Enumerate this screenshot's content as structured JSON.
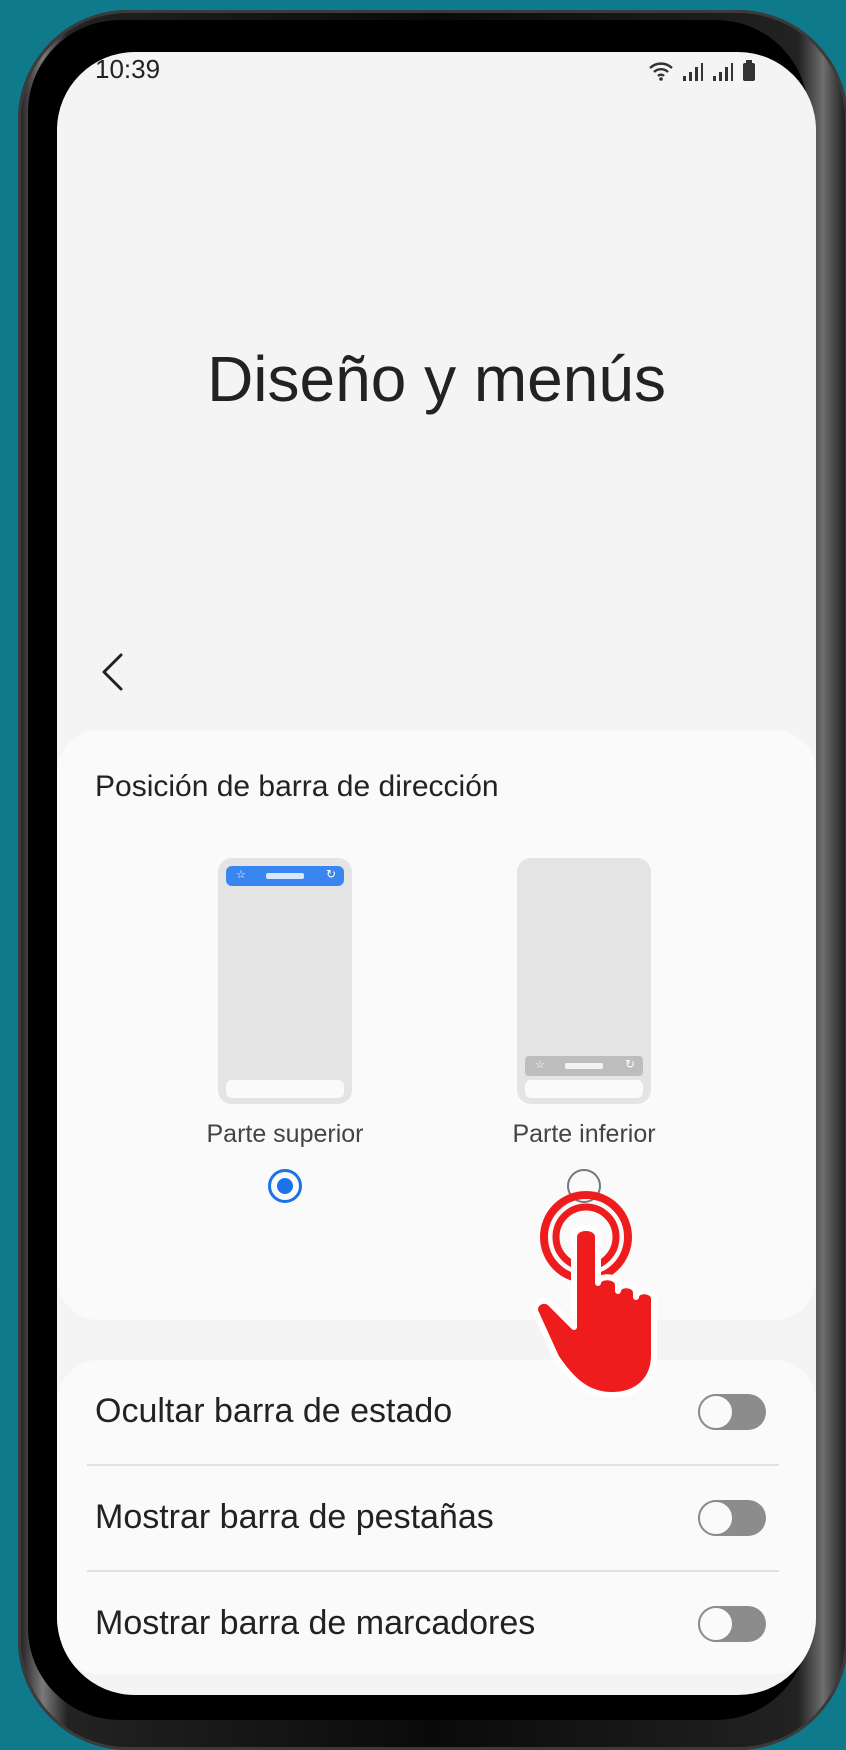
{
  "status_bar": {
    "time": "10:39"
  },
  "page": {
    "title": "Diseño y menús"
  },
  "address_bar_position": {
    "section_title": "Posición de barra de dirección",
    "options": [
      {
        "label": "Parte superior",
        "selected": true
      },
      {
        "label": "Parte inferior",
        "selected": false
      }
    ]
  },
  "toggles": [
    {
      "label": "Ocultar barra de estado",
      "on": false
    },
    {
      "label": "Mostrar barra de pestañas",
      "on": false
    },
    {
      "label": "Mostrar barra de marcadores",
      "on": false
    }
  ],
  "colors": {
    "background": "#0e7a8c",
    "accent": "#1a73e8",
    "tap_indicator": "#ee1c1c"
  },
  "icons": {
    "back": "chevron-left-icon",
    "wifi": "wifi-icon",
    "signal": "signal-icon",
    "battery": "battery-icon",
    "tap": "tap-hand-icon"
  }
}
